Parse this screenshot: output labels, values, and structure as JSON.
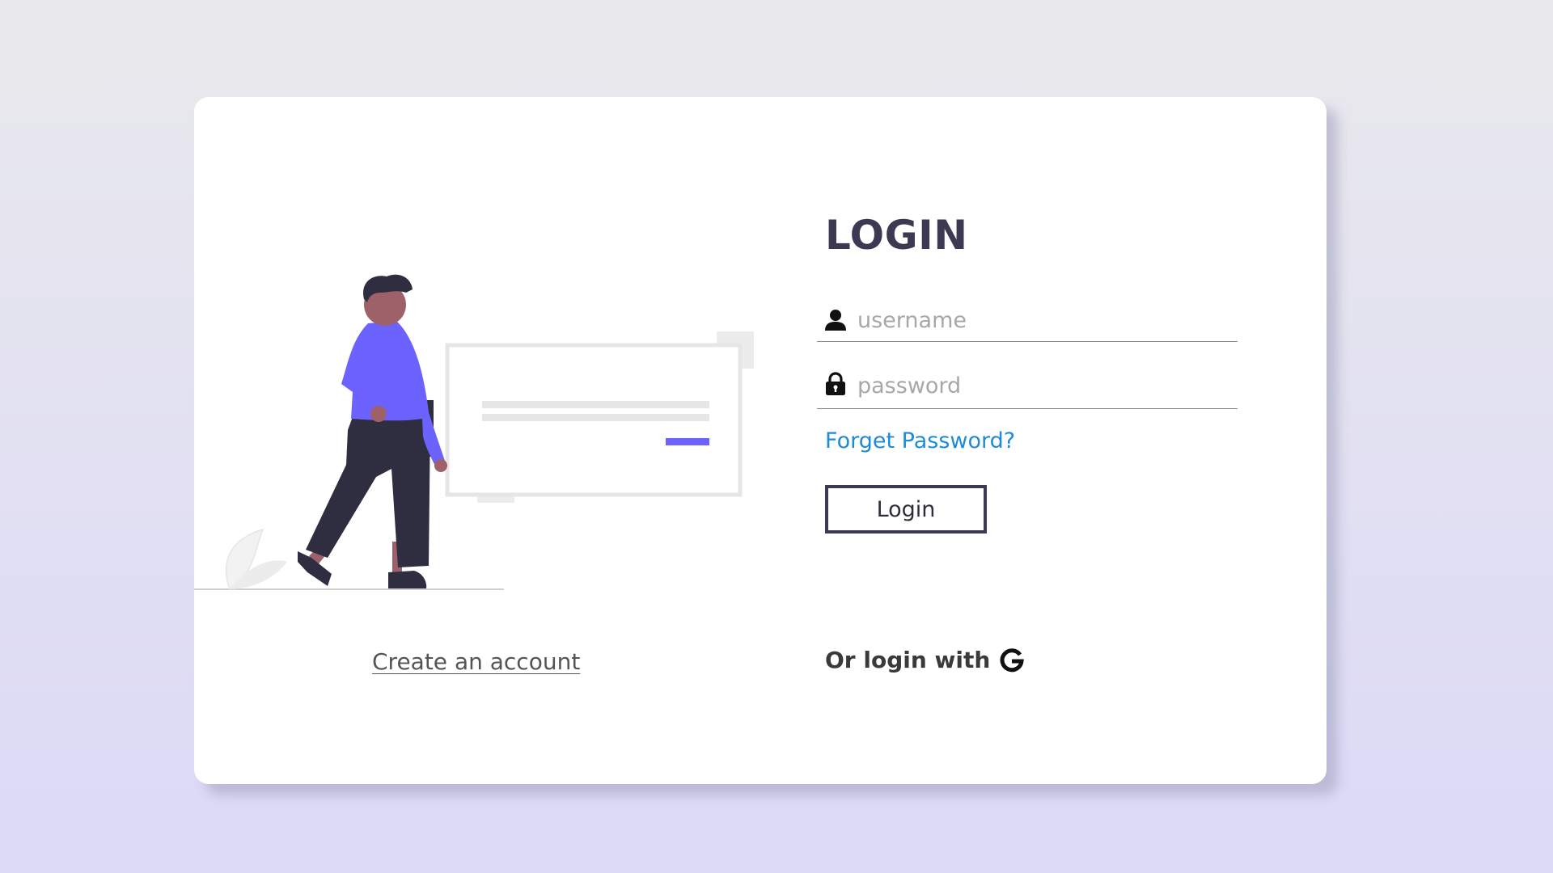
{
  "login": {
    "title": "LOGIN",
    "username_placeholder": "username",
    "password_placeholder": "password",
    "forgot_label": "Forget Password?",
    "submit_label": "Login",
    "social_prefix": "Or login with"
  },
  "signup": {
    "create_account_label": "Create an account"
  },
  "icons": {
    "username": "user-icon",
    "password": "lock-icon",
    "social": "google-icon"
  },
  "colors": {
    "accent": "#6c63ff",
    "title": "#3b3a52",
    "link": "#1e8bd6",
    "button_border": "#3b3a52"
  }
}
